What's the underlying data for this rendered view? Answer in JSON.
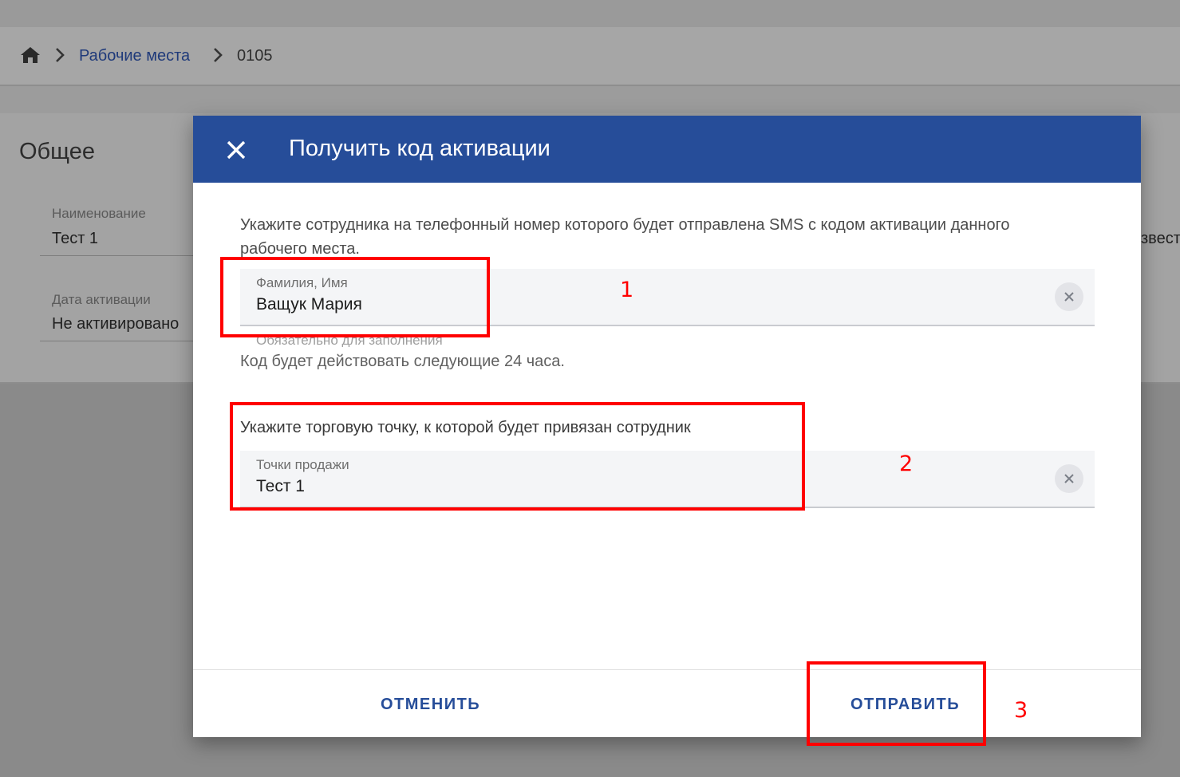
{
  "breadcrumb": {
    "home_icon": "home-icon",
    "separator_icon": "chevron-right-icon",
    "items": [
      "Рабочие места",
      "0105"
    ]
  },
  "background": {
    "card_title": "Общее",
    "fields": [
      {
        "label": "Наименование",
        "value": "Тест 1"
      },
      {
        "label": "Дата активации",
        "value": "Не активировано"
      }
    ],
    "cut_text": "звест"
  },
  "dialog": {
    "title": "Получить код активации",
    "close_icon": "close-icon",
    "header_color": "#264d99",
    "description": "Укажите сотрудника на телефонный номер которого будет отправлена SMS с кодом активации данного рабочего места.",
    "employee_field": {
      "label": "Фамилия, Имя",
      "value": "Ващук Мария",
      "hint": "Обязательно для заполнения"
    },
    "code_note": "Код будет действовать следующие 24 часа.",
    "store_section_label": "Укажите торговую точку, к которой будет привязан сотрудник",
    "store_field": {
      "label": "Точки продажи",
      "value": "Тест 1"
    },
    "cancel_label": "ОТМЕНИТЬ",
    "send_label": "ОТПРАВИТЬ"
  },
  "annotations": {
    "color": "#ff0000",
    "numbers": [
      "1",
      "2",
      "3"
    ]
  }
}
